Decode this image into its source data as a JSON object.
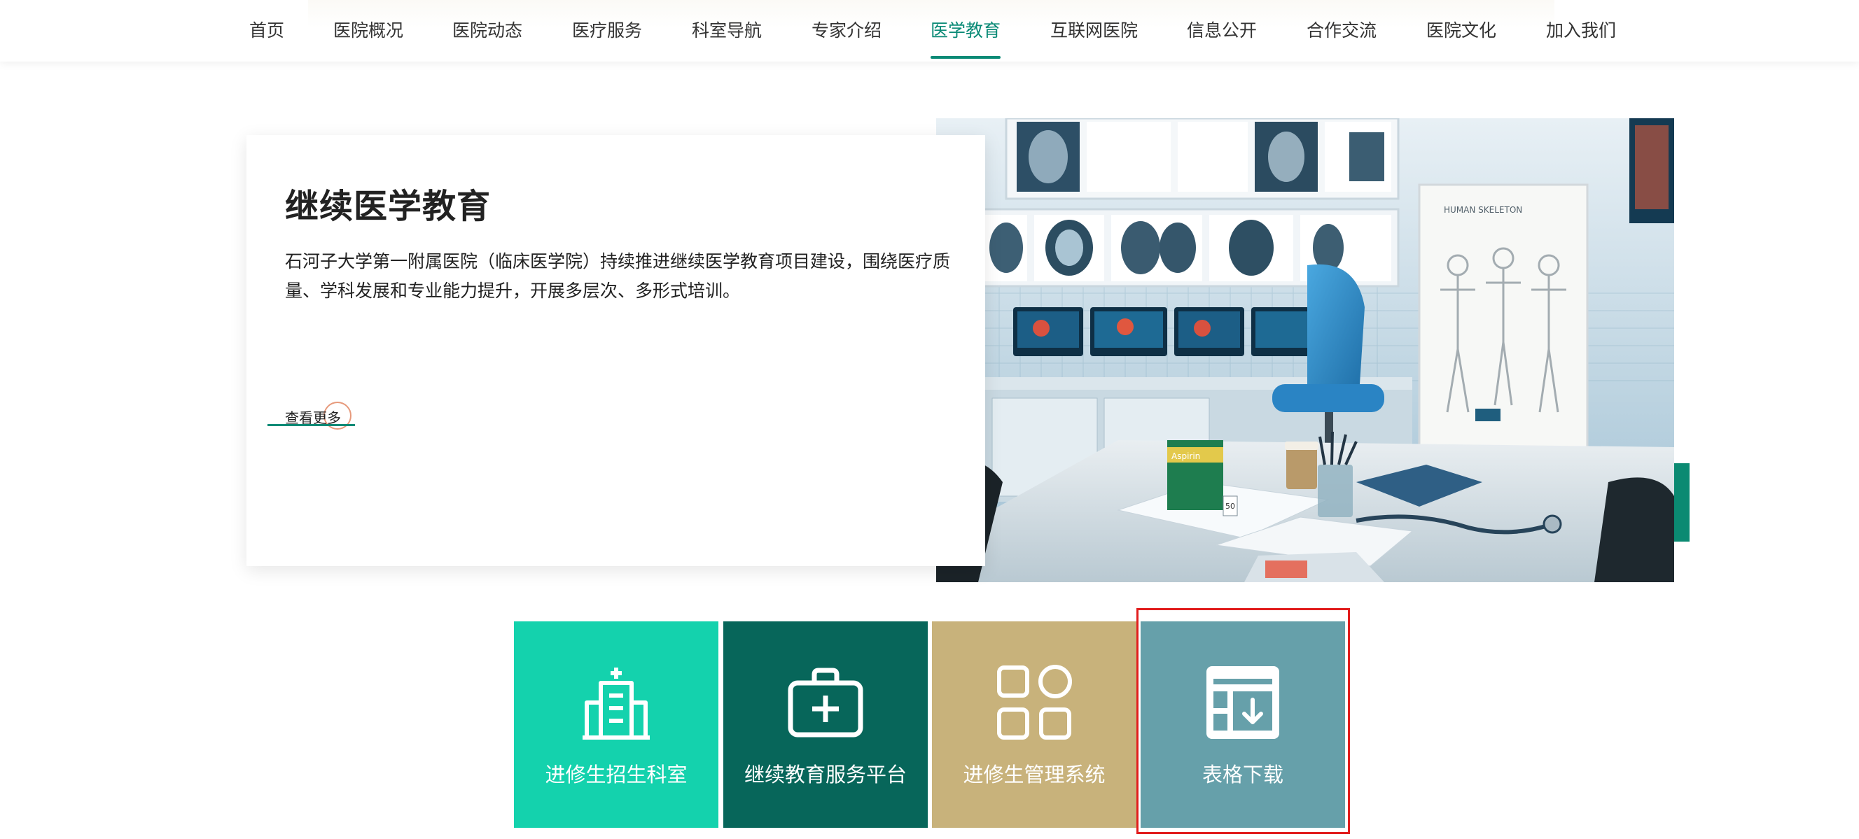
{
  "nav": {
    "items": [
      {
        "label": "首页"
      },
      {
        "label": "医院概况"
      },
      {
        "label": "医院动态"
      },
      {
        "label": "医疗服务"
      },
      {
        "label": "科室导航"
      },
      {
        "label": "专家介绍"
      },
      {
        "label": "医学教育"
      },
      {
        "label": "互联网医院"
      },
      {
        "label": "信息公开"
      },
      {
        "label": "合作交流"
      },
      {
        "label": "医院文化"
      },
      {
        "label": "加入我们"
      }
    ],
    "active": "医学教育"
  },
  "hero": {
    "title": "继续医学教育",
    "description": "石河子大学第一附属医院（临床医学院）持续推进继续医学教育项目建设，围绕医疗质量、学科发展和专业能力提升，开展多层次、多形式培训。",
    "more_label": "查看更多"
  },
  "photo": {
    "poster_title": "HUMAN SKELETON",
    "box_label": "Aspirin",
    "box_number": "50"
  },
  "tiles": [
    {
      "label": "进修生招生科室",
      "icon": "hospital-icon",
      "color": "#14d2ad"
    },
    {
      "label": "继续教育服务平台",
      "icon": "medical-kit-icon",
      "color": "#07665a"
    },
    {
      "label": "进修生管理系统",
      "icon": "app-grid-icon",
      "color": "#c8b27b"
    },
    {
      "label": "表格下载",
      "icon": "form-download-icon",
      "color": "#66a0aa"
    }
  ],
  "colors": {
    "accent": "#0a8a76",
    "highlight": "#e11d1d"
  }
}
